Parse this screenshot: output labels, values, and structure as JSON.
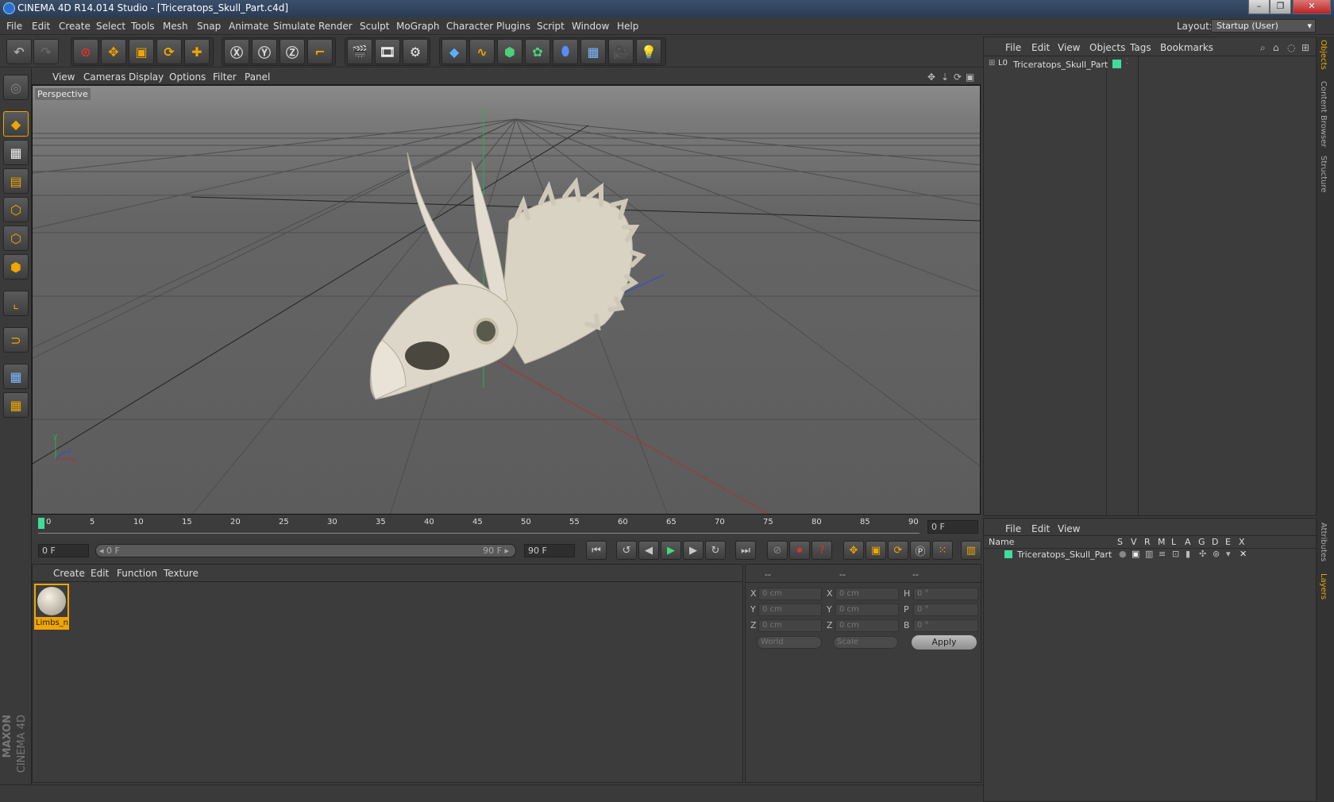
{
  "window": {
    "title": "CINEMA 4D R14.014 Studio - [Triceratops_Skull_Part.c4d]",
    "min": "–",
    "max": "❐",
    "close": "✕"
  },
  "menu": [
    "File",
    "Edit",
    "Create",
    "Select",
    "Tools",
    "Mesh",
    "Snap",
    "Animate",
    "Simulate",
    "Render",
    "Sculpt",
    "MoGraph",
    "Character",
    "Plugins",
    "Script",
    "Window",
    "Help"
  ],
  "layout": {
    "label": "Layout:",
    "value": "Startup (User)"
  },
  "viewport": {
    "menu": [
      "View",
      "Cameras",
      "Display",
      "Options",
      "Filter",
      "Panel"
    ],
    "label": "Perspective",
    "axis": {
      "y": "y",
      "x": "x",
      "z": "z"
    }
  },
  "timeline": {
    "ticks": [
      "0",
      "5",
      "10",
      "15",
      "20",
      "25",
      "30",
      "35",
      "40",
      "45",
      "50",
      "55",
      "60",
      "65",
      "70",
      "75",
      "80",
      "85",
      "90"
    ],
    "current": "0 F"
  },
  "playback": {
    "start": "0 F",
    "range_left": "◂ 0 F",
    "range_right": "90 F ▸",
    "end": "90 F"
  },
  "material_manager": {
    "menu": [
      "Create",
      "Edit",
      "Function",
      "Texture"
    ],
    "materials": [
      {
        "name": "Limbs_n"
      }
    ]
  },
  "coordinates": {
    "header": [
      "--",
      "--",
      "--"
    ],
    "rows": [
      {
        "a": "X",
        "av": "0 cm",
        "b": "X",
        "bv": "0 cm",
        "c": "H",
        "cv": "0 °"
      },
      {
        "a": "Y",
        "av": "0 cm",
        "b": "Y",
        "bv": "0 cm",
        "c": "P",
        "cv": "0 °"
      },
      {
        "a": "Z",
        "av": "0 cm",
        "b": "Z",
        "bv": "0 cm",
        "c": "B",
        "cv": "0 °"
      }
    ],
    "space": "World",
    "mode": "Scale",
    "apply": "Apply"
  },
  "object_manager": {
    "menu": [
      "File",
      "Edit",
      "View",
      "Objects",
      "Tags",
      "Bookmarks"
    ],
    "objects": [
      {
        "name": "Triceratops_Skull_Part",
        "color": "#3fdc9c"
      }
    ]
  },
  "layer_manager": {
    "menu": [
      "File",
      "Edit",
      "View"
    ],
    "columns": [
      "Name",
      "S",
      "V",
      "R",
      "M",
      "L",
      "A",
      "G",
      "D",
      "E",
      "X"
    ],
    "layers": [
      {
        "name": "Triceratops_Skull_Part",
        "color": "#3fdc9c"
      }
    ]
  },
  "side_tabs": [
    "Objects",
    "Content Browser",
    "Structure",
    "Attributes",
    "Layers"
  ],
  "brand": {
    "line1": "MAXON",
    "line2": "CINEMA 4D"
  },
  "colors": {
    "accent": "#f0a500",
    "layer": "#3fdc9c",
    "x_axis": "#c0392b",
    "y_axis": "#27ae60",
    "z_axis": "#2e4dd6"
  }
}
